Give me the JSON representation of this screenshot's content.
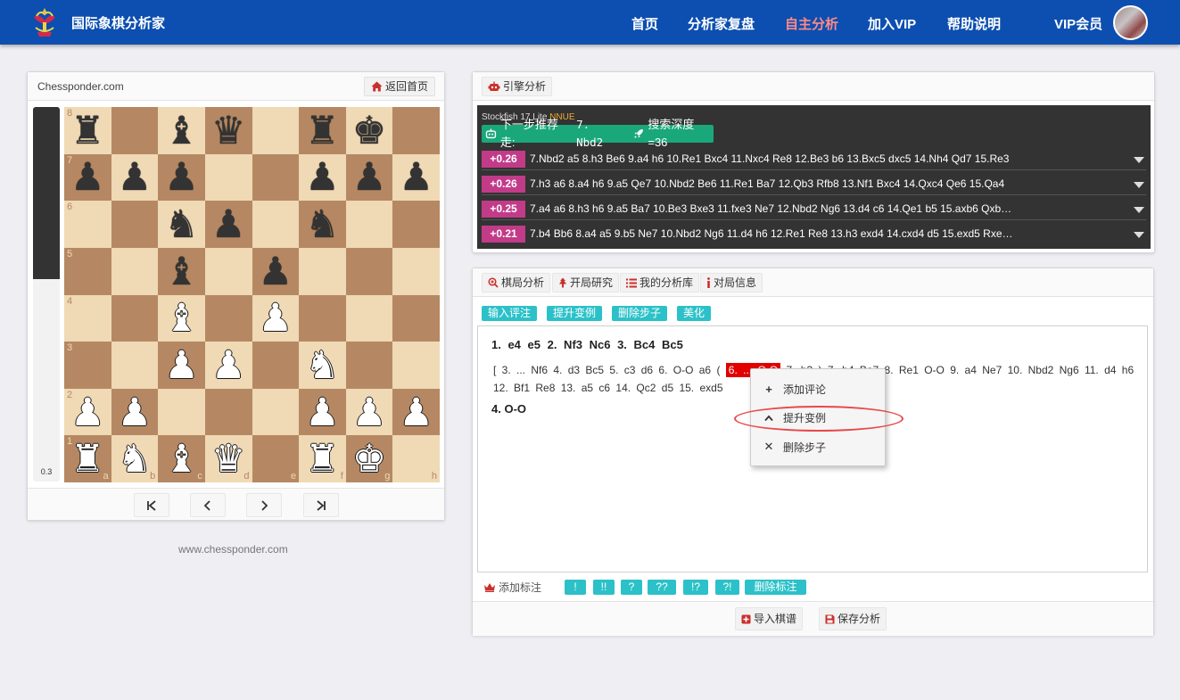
{
  "header": {
    "brand": "国际象棋分析家",
    "nav": [
      {
        "label": "首页",
        "active": false
      },
      {
        "label": "分析家复盘",
        "active": false
      },
      {
        "label": "自主分析",
        "active": true
      },
      {
        "label": "加入VIP",
        "active": false
      },
      {
        "label": "帮助说明",
        "active": false
      }
    ],
    "vip_label": "VIP会员"
  },
  "board_panel": {
    "site_name": "Chessponder.com",
    "home_button": "返回首页",
    "eval_text": "0.3",
    "eval_white_fraction": 0.54,
    "ranks": [
      "8",
      "7",
      "6",
      "5",
      "4",
      "3",
      "2",
      "1"
    ],
    "files": [
      "a",
      "b",
      "c",
      "d",
      "e",
      "f",
      "g",
      "h"
    ],
    "position": [
      [
        "bR",
        "",
        "bB",
        "bQ",
        "",
        "bR",
        "bK",
        ""
      ],
      [
        "bP",
        "bP",
        "bP",
        "",
        "",
        "bP",
        "bP",
        "bP"
      ],
      [
        "",
        "",
        "bN",
        "bP",
        "",
        "bN",
        "",
        ""
      ],
      [
        "",
        "",
        "bB",
        "",
        "bP",
        "",
        "",
        ""
      ],
      [
        "",
        "",
        "wB",
        "",
        "wP",
        "",
        "",
        ""
      ],
      [
        "",
        "",
        "wP",
        "wP",
        "",
        "wN",
        "",
        ""
      ],
      [
        "wP",
        "wP",
        "",
        "",
        "",
        "wP",
        "wP",
        "wP"
      ],
      [
        "wR",
        "wN",
        "wB",
        "wQ",
        "",
        "wR",
        "wK",
        ""
      ]
    ],
    "footer_url": "www.chessponder.com"
  },
  "engine_panel": {
    "tab_label": "引擎分析",
    "engine_name": "Stockfish 17 Lite",
    "engine_tag": "NNUE",
    "recommend_label": "下一步推荐走:",
    "recommend_move": "7. Nbd2",
    "depth_label": "搜索深度=36",
    "lines": [
      {
        "score": "+0.26",
        "moves": "7.Nbd2 a5 8.h3 Be6 9.a4 h6 10.Re1 Bxc4 11.Nxc4 Re8 12.Be3 b6 13.Bxc5 dxc5 14.Nh4 Qd7 15.Re3"
      },
      {
        "score": "+0.26",
        "moves": "7.h3 a6 8.a4 h6 9.a5 Qe7 10.Nbd2 Be6 11.Re1 Ba7 12.Qb3 Rfb8 13.Nf1 Bxc4 14.Qxc4 Qe6 15.Qa4"
      },
      {
        "score": "+0.25",
        "moves": "7.a4 a6 8.h3 h6 9.a5 Ba7 10.Be3 Bxe3 11.fxe3 Ne7 12.Nbd2 Ng6 13.d4 c6 14.Qe1 b5 15.axb6 Qxb…"
      },
      {
        "score": "+0.21",
        "moves": "7.b4 Bb6 8.a4 a5 9.b5 Ne7 10.Nbd2 Ng6 11.d4 h6 12.Re1 Re8 13.h3 exd4 14.cxd4 d5 15.exd5 Rxe…"
      }
    ]
  },
  "analysis_panel": {
    "tabs": [
      "棋局分析",
      "开局研究",
      "我的分析库",
      "对局信息"
    ],
    "actions": [
      "输入评注",
      "提升变例",
      "删除步子",
      "美化"
    ],
    "main_line": "1. e4  e5  2. Nf3  Nc6  3. Bc4  Bc5",
    "variation": {
      "before": "[  3. ... Nf6  4. d3  Bc5  5. c3  d6  6. O-O  a6 (",
      "highlight": "6. ... O-O",
      "after": "7. h3  )  7. b4  Ba7  8. Re1  O-O  9. a4  Ne7  10. Nbd2  Ng6  11. d4  h6  12. Bf1  Re8  13. a5  c6  14. Qc2  d5  15. exd5"
    },
    "main_line2": "4. O-O",
    "context_menu": [
      "添加评论",
      "提升变例",
      "删除步子"
    ],
    "annot_label": "添加标注",
    "annot_buttons": [
      "!",
      "!!",
      "?",
      "??",
      "!?",
      "?!",
      "删除标注"
    ],
    "import_label": "导入棋谱",
    "save_label": "保存分析"
  }
}
